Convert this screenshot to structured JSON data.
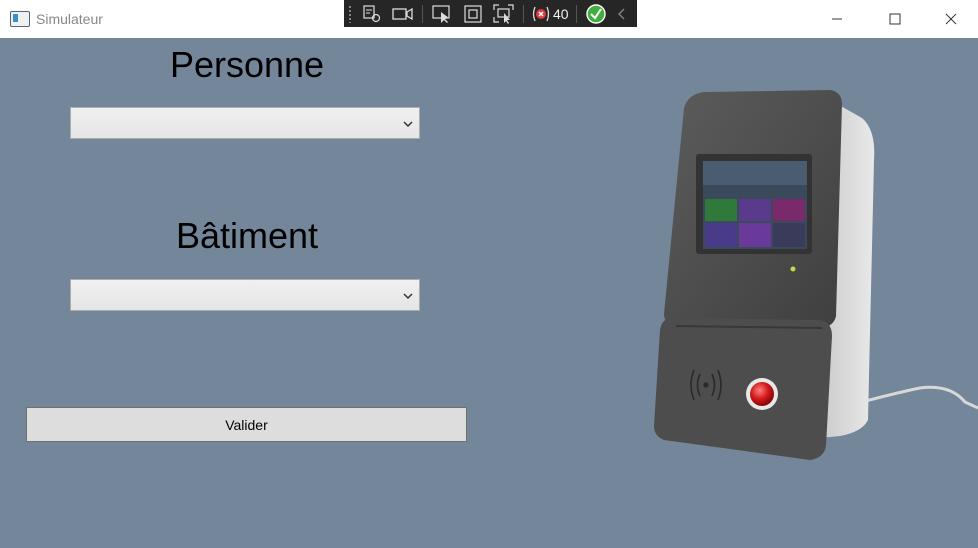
{
  "window": {
    "title": "Simulateur"
  },
  "debug_toolbar": {
    "error_count": "40"
  },
  "form": {
    "person_label": "Personne",
    "person_value": "",
    "building_label": "Bâtiment",
    "building_value": "",
    "submit_label": "Valider"
  },
  "icons": [
    "app-icon",
    "live-visual-tree-icon",
    "record-icon",
    "select-element-icon",
    "display-layout-adorners-icon",
    "track-focus-icon",
    "binding-errors-icon",
    "hot-reload-ok-icon",
    "collapse-toolbar-icon",
    "minimize-icon",
    "maximize-icon",
    "close-icon",
    "chevron-down-icon",
    "badge-reader-device"
  ],
  "colors": {
    "background": "#73869a",
    "titlebar": "#ffffff",
    "toolbar": "#262626",
    "button": "#dddddd"
  }
}
